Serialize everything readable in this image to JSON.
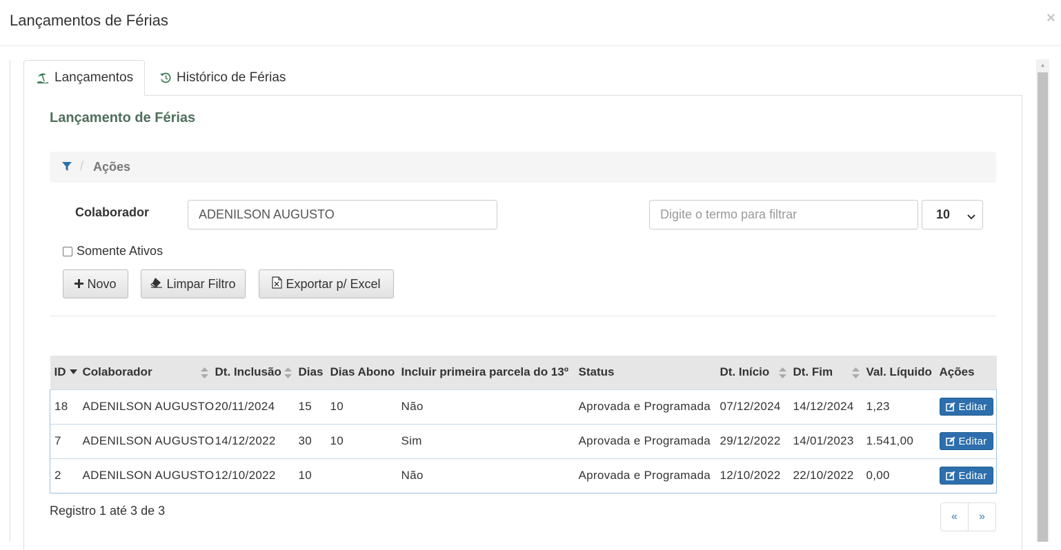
{
  "modal": {
    "title": "Lançamentos de Férias",
    "close": "×"
  },
  "tabs": [
    {
      "label": "Lançamentos",
      "icon": "beach-umbrella-icon"
    },
    {
      "label": "Histórico de Férias",
      "icon": "history-icon"
    }
  ],
  "section": {
    "title": "Lançamento de Férias"
  },
  "breadcrumb": {
    "icon": "filter-icon",
    "separator": "/",
    "label": "Ações"
  },
  "filters": {
    "colaborador_label": "Colaborador",
    "colaborador_value": "ADENILSON AUGUSTO",
    "search_placeholder": "Digite o termo para filtrar",
    "page_size": "10",
    "somente_ativos_label": "Somente Ativos",
    "somente_ativos_checked": false
  },
  "buttons": {
    "novo": "Novo",
    "limpar": "Limpar Filtro",
    "exportar": "Exportar p/ Excel"
  },
  "table": {
    "headers": [
      "ID",
      "Colaborador",
      "Dt. Inclusão",
      "Dias",
      "Dias Abono",
      "Incluir primeira parcela do 13º",
      "Status",
      "Dt. Início",
      "Dt. Fim",
      "Val. Líquido",
      "Ações"
    ],
    "rows": [
      [
        "18",
        "ADENILSON AUGUSTO",
        "20/11/2024",
        "15",
        "10",
        "Não",
        "Aprovada e Programada",
        "07/12/2024",
        "14/12/2024",
        "1,23"
      ],
      [
        "7",
        "ADENILSON AUGUSTO",
        "14/12/2022",
        "30",
        "10",
        "Sim",
        "Aprovada e Programada",
        "29/12/2022",
        "14/01/2023",
        "1.541,00"
      ],
      [
        "2",
        "ADENILSON AUGUSTO",
        "12/10/2022",
        "10",
        "",
        "Não",
        "Aprovada e Programada",
        "12/10/2022",
        "22/10/2022",
        "0,00"
      ]
    ],
    "edit_label": "Editar"
  },
  "footer": {
    "info": "Registro 1 até 3 de 3",
    "prev": "«",
    "next": "»"
  },
  "colors": {
    "accent": "#2d6fad",
    "title_green": "#4e6f5c",
    "header_bg": "#e6e6e6"
  }
}
